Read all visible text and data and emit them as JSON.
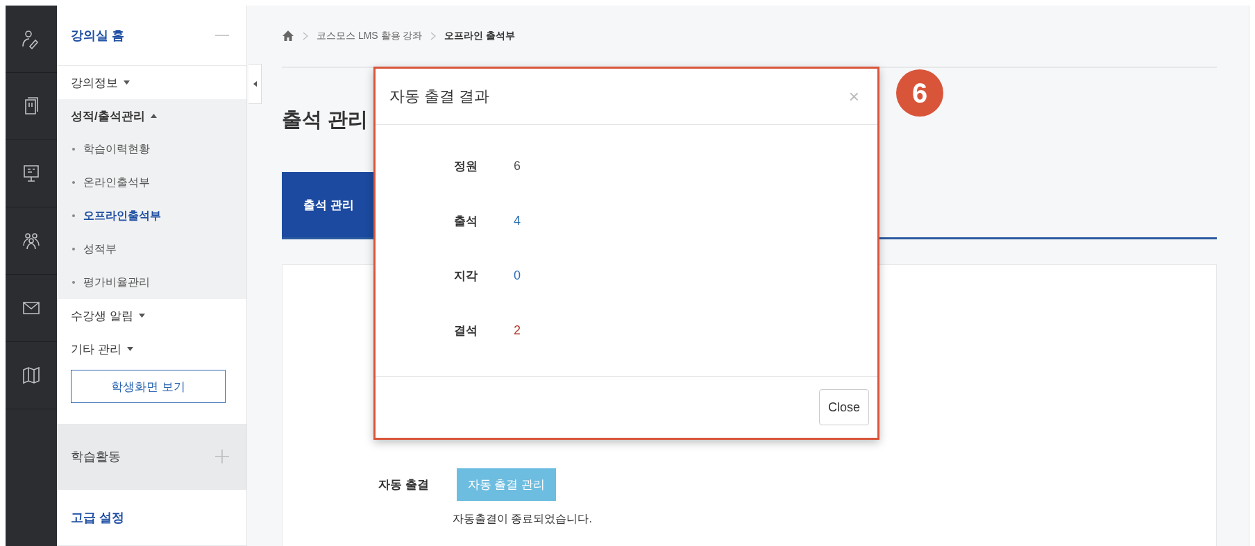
{
  "sidebar": {
    "sections": [
      {
        "title": "강의실 홈",
        "expanded": true,
        "items": [
          {
            "label": "강의정보",
            "expanded": false
          },
          {
            "label": "성적/출석관리",
            "expanded": true,
            "children": [
              {
                "label": "학습이력현황",
                "selected": false
              },
              {
                "label": "온라인출석부",
                "selected": false
              },
              {
                "label": "오프라인출석부",
                "selected": true
              },
              {
                "label": "성적부",
                "selected": false
              },
              {
                "label": "평가비율관리",
                "selected": false
              }
            ]
          },
          {
            "label": "수강생 알림",
            "expanded": false
          },
          {
            "label": "기타 관리",
            "expanded": false
          }
        ],
        "button": "학생화면 보기"
      },
      {
        "title": "학습활동",
        "expanded": false
      },
      {
        "title": "고급 설정"
      }
    ]
  },
  "breadcrumb": [
    "코스모스 LMS 활용 강좌",
    "오프라인 출석부"
  ],
  "page": {
    "title": "출석 관리",
    "tabs": [
      {
        "label": "출석 관리",
        "selected": true
      }
    ],
    "auto": {
      "label": "자동 출결",
      "button": "자동 출결 관리",
      "message": "자동출결이 종료되었습니다."
    }
  },
  "modal": {
    "title": "자동 출결 결과",
    "close_symbol": "×",
    "button": "Close",
    "rows": [
      {
        "label": "정원",
        "value": "6",
        "color": "#555555"
      },
      {
        "label": "출석",
        "value": "4",
        "color": "#2a6db5"
      },
      {
        "label": "지각",
        "value": "0",
        "color": "#2a6db5"
      },
      {
        "label": "결석",
        "value": "2",
        "color": "#b03a2e"
      }
    ]
  },
  "callout": {
    "number": "6"
  }
}
